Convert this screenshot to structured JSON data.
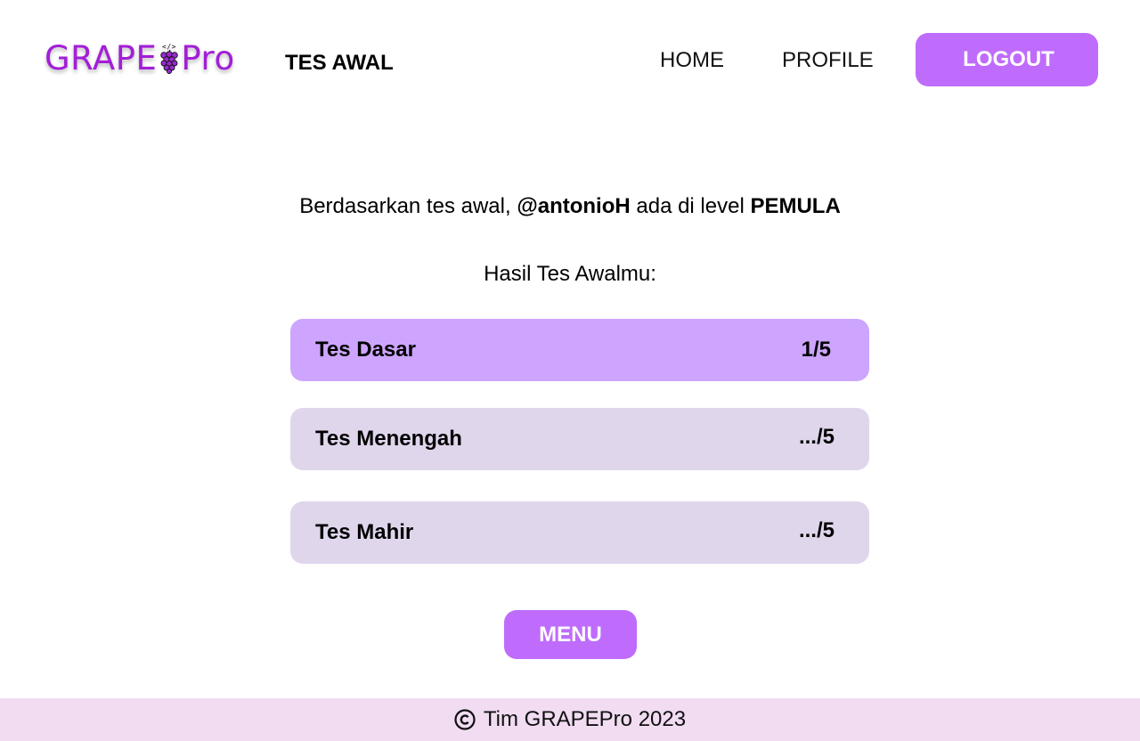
{
  "header": {
    "logo_left": "GRAPE",
    "logo_right": "Pro",
    "page_title": "TES AWAL",
    "nav": {
      "home": "HOME",
      "profile": "PROFILE",
      "logout": "LOGOUT"
    }
  },
  "result": {
    "prefix": "Berdasarkan tes awal, ",
    "username": "@antonioH",
    "middle": " ada di level ",
    "level": "PEMULA",
    "hasil_label": "Hasil Tes Awalmu:"
  },
  "tests": [
    {
      "name": "Tes Dasar",
      "score": "1/5"
    },
    {
      "name": "Tes Menengah",
      "score": ".../5"
    },
    {
      "name": "Tes Mahir",
      "score": ".../5"
    }
  ],
  "menu_label": "MENU",
  "footer": {
    "text": "Tim GRAPEPro 2023"
  },
  "colors": {
    "brand": "#a21fd6",
    "button": "#bf6cfc",
    "active_card": "#cda5fe",
    "inactive_card": "#e0d6ec",
    "footer_bg": "#f1dcf2"
  },
  "icons": {
    "logo_glyph": "grape-icon",
    "footer_glyph": "copyright-icon"
  }
}
